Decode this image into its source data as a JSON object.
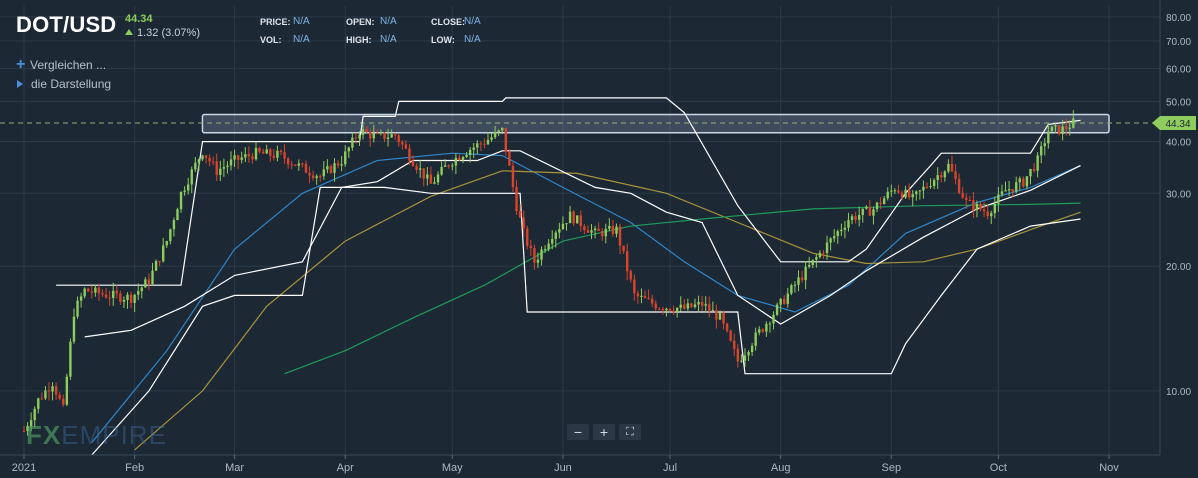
{
  "header": {
    "ticker": "DOT/USD",
    "last": "44.34",
    "change": "1.32 (3.07%)",
    "ohlc": [
      {
        "label": "PRICE:",
        "value": "N/A"
      },
      {
        "label": "VOL:",
        "value": "N/A"
      },
      {
        "label": "OPEN:",
        "value": "N/A"
      },
      {
        "label": "HIGH:",
        "value": "N/A"
      },
      {
        "label": "CLOSE:",
        "value": "N/A"
      },
      {
        "label": "LOW:",
        "value": "N/A"
      }
    ]
  },
  "menu": {
    "compare": "Vergleichen ...",
    "display": "die Darstellung"
  },
  "zoom": {
    "minus": "−",
    "plus": "+",
    "fullscreen": "⛶"
  },
  "logo": {
    "fx": "FX",
    "empire": "EMPIRE"
  },
  "colors": {
    "up": "#8dcc5d",
    "down": "#d9442c",
    "ma_fast": "#2f86c8",
    "ma_mid": "#a8943c",
    "ma_slow": "#1f9a5a",
    "channel": "#ffffff",
    "resistance_box": "#c8d6e8"
  },
  "chart_data": {
    "type": "candlestick",
    "symbol": "DOT/USD",
    "y_scale": "log",
    "ylim": [
      7,
      85
    ],
    "y_ticks": [
      10,
      20,
      30,
      40,
      50,
      60,
      70,
      80
    ],
    "y_tick_labels": [
      "10.00",
      "20.00",
      "30.00",
      "40.00",
      "50.00",
      "60.00",
      "70.00",
      "80.00"
    ],
    "x_range": [
      "2021-01-01",
      "2021-11-08"
    ],
    "x_ticks": [
      {
        "date": "2021-01-01",
        "label": "2021"
      },
      {
        "date": "2021-02-01",
        "label": "Feb"
      },
      {
        "date": "2021-03-01",
        "label": "Mar"
      },
      {
        "date": "2021-04-01",
        "label": "Apr"
      },
      {
        "date": "2021-05-01",
        "label": "May"
      },
      {
        "date": "2021-06-01",
        "label": "Jun"
      },
      {
        "date": "2021-07-01",
        "label": "Jul"
      },
      {
        "date": "2021-08-01",
        "label": "Aug"
      },
      {
        "date": "2021-09-01",
        "label": "Sep"
      },
      {
        "date": "2021-10-01",
        "label": "Oct"
      },
      {
        "date": "2021-11-01",
        "label": "Nov"
      }
    ],
    "last_price": 44.34,
    "last_price_label": "44.34",
    "resistance_zone": {
      "from": "2021-02-20",
      "to": "2021-11-01",
      "low": 42.0,
      "high": 46.5,
      "level": 44.34
    },
    "price_path": [
      [
        "2021-01-01",
        8.0
      ],
      [
        "2021-01-05",
        9.5
      ],
      [
        "2021-01-09",
        10.5
      ],
      [
        "2021-01-12",
        9.0
      ],
      [
        "2021-01-15",
        15.5
      ],
      [
        "2021-01-18",
        17.5
      ],
      [
        "2021-01-25",
        17.0
      ],
      [
        "2021-01-31",
        16.8
      ],
      [
        "2021-02-05",
        18.5
      ],
      [
        "2021-02-10",
        23.0
      ],
      [
        "2021-02-14",
        30.0
      ],
      [
        "2021-02-20",
        38.0
      ],
      [
        "2021-02-24",
        34.0
      ],
      [
        "2021-03-01",
        36.0
      ],
      [
        "2021-03-07",
        37.5
      ],
      [
        "2021-03-14",
        37.0
      ],
      [
        "2021-03-20",
        34.5
      ],
      [
        "2021-03-25",
        33.0
      ],
      [
        "2021-03-31",
        36.0
      ],
      [
        "2021-04-05",
        42.5
      ],
      [
        "2021-04-10",
        41.0
      ],
      [
        "2021-04-15",
        41.5
      ],
      [
        "2021-04-20",
        36.0
      ],
      [
        "2021-04-25",
        31.5
      ],
      [
        "2021-04-30",
        35.5
      ],
      [
        "2021-05-05",
        38.0
      ],
      [
        "2021-05-10",
        40.0
      ],
      [
        "2021-05-15",
        42.5
      ],
      [
        "2021-05-19",
        28.0
      ],
      [
        "2021-05-21",
        24.0
      ],
      [
        "2021-05-24",
        20.5
      ],
      [
        "2021-05-29",
        24.0
      ],
      [
        "2021-06-03",
        26.5
      ],
      [
        "2021-06-10",
        24.0
      ],
      [
        "2021-06-16",
        24.5
      ],
      [
        "2021-06-21",
        17.0
      ],
      [
        "2021-06-28",
        16.0
      ],
      [
        "2021-07-05",
        15.8
      ],
      [
        "2021-07-10",
        16.2
      ],
      [
        "2021-07-15",
        15.0
      ],
      [
        "2021-07-20",
        11.8
      ],
      [
        "2021-07-25",
        13.5
      ],
      [
        "2021-07-31",
        15.8
      ],
      [
        "2021-08-06",
        18.5
      ],
      [
        "2021-08-13",
        22.0
      ],
      [
        "2021-08-20",
        26.0
      ],
      [
        "2021-08-27",
        27.5
      ],
      [
        "2021-09-02",
        31.0
      ],
      [
        "2021-09-07",
        29.0
      ],
      [
        "2021-09-12",
        32.0
      ],
      [
        "2021-09-17",
        35.0
      ],
      [
        "2021-09-22",
        28.5
      ],
      [
        "2021-09-28",
        27.0
      ],
      [
        "2021-10-03",
        30.5
      ],
      [
        "2021-10-08",
        32.0
      ],
      [
        "2021-10-12",
        36.0
      ],
      [
        "2021-10-15",
        42.5
      ],
      [
        "2021-10-19",
        42.8
      ],
      [
        "2021-10-22",
        44.34
      ]
    ],
    "moving_averages": [
      {
        "color": "#2f86c8",
        "points": [
          [
            "2021-01-20",
            7.5
          ],
          [
            "2021-02-10",
            12.5
          ],
          [
            "2021-03-01",
            22.0
          ],
          [
            "2021-03-20",
            30.0
          ],
          [
            "2021-04-10",
            36.0
          ],
          [
            "2021-05-01",
            37.5
          ],
          [
            "2021-05-15",
            37.0
          ],
          [
            "2021-06-01",
            31.0
          ],
          [
            "2021-06-20",
            25.5
          ],
          [
            "2021-07-05",
            20.5
          ],
          [
            "2021-07-20",
            17.0
          ],
          [
            "2021-08-05",
            15.5
          ],
          [
            "2021-08-20",
            18.0
          ],
          [
            "2021-09-05",
            24.0
          ],
          [
            "2021-09-25",
            28.5
          ],
          [
            "2021-10-10",
            31.0
          ],
          [
            "2021-10-24",
            35.0
          ]
        ]
      },
      {
        "color": "#a8943c",
        "points": [
          [
            "2021-02-01",
            7.2
          ],
          [
            "2021-02-20",
            10.0
          ],
          [
            "2021-03-10",
            16.0
          ],
          [
            "2021-04-01",
            23.0
          ],
          [
            "2021-04-25",
            29.5
          ],
          [
            "2021-05-15",
            34.0
          ],
          [
            "2021-06-05",
            33.5
          ],
          [
            "2021-06-30",
            30.0
          ],
          [
            "2021-07-20",
            25.5
          ],
          [
            "2021-08-10",
            21.5
          ],
          [
            "2021-08-25",
            20.3
          ],
          [
            "2021-09-10",
            20.5
          ],
          [
            "2021-09-25",
            22.0
          ],
          [
            "2021-10-10",
            24.5
          ],
          [
            "2021-10-24",
            27.0
          ]
        ]
      },
      {
        "color": "#1f9a5a",
        "points": [
          [
            "2021-03-15",
            11.0
          ],
          [
            "2021-04-01",
            12.5
          ],
          [
            "2021-04-20",
            15.0
          ],
          [
            "2021-05-10",
            18.0
          ],
          [
            "2021-06-01",
            23.0
          ],
          [
            "2021-06-20",
            25.0
          ],
          [
            "2021-07-10",
            26.0
          ],
          [
            "2021-08-10",
            27.5
          ],
          [
            "2021-09-10",
            28.0
          ],
          [
            "2021-10-10",
            28.2
          ],
          [
            "2021-10-24",
            28.4
          ]
        ]
      }
    ],
    "channel_bands": [
      [
        [
          "2021-01-10",
          18.0
        ],
        [
          "2021-01-18",
          18.0
        ],
        [
          "2021-02-14",
          18.0
        ],
        [
          "2021-02-20",
          40.0
        ],
        [
          "2021-04-05",
          40.0
        ],
        [
          "2021-04-06",
          46.0
        ],
        [
          "2021-04-15",
          46.0
        ],
        [
          "2021-04-16",
          50.0
        ],
        [
          "2021-05-15",
          50.0
        ],
        [
          "2021-05-16",
          51.0
        ],
        [
          "2021-06-30",
          51.0
        ],
        [
          "2021-07-05",
          47.0
        ],
        [
          "2021-07-20",
          28.0
        ],
        [
          "2021-08-01",
          20.5
        ],
        [
          "2021-08-20",
          20.5
        ],
        [
          "2021-08-25",
          22.0
        ],
        [
          "2021-09-05",
          30.0
        ],
        [
          "2021-09-12",
          35.0
        ],
        [
          "2021-09-15",
          37.5
        ],
        [
          "2021-10-10",
          37.5
        ],
        [
          "2021-10-15",
          44.0
        ],
        [
          "2021-10-24",
          45.0
        ]
      ],
      [
        [
          "2021-01-18",
          13.5
        ],
        [
          "2021-01-31",
          14.0
        ],
        [
          "2021-02-15",
          16.0
        ],
        [
          "2021-03-01",
          19.0
        ],
        [
          "2021-03-20",
          20.5
        ],
        [
          "2021-03-31",
          31.0
        ],
        [
          "2021-04-10",
          32.0
        ],
        [
          "2021-04-20",
          36.0
        ],
        [
          "2021-05-08",
          36.0
        ],
        [
          "2021-05-15",
          38.0
        ],
        [
          "2021-05-20",
          38.0
        ],
        [
          "2021-06-10",
          31.0
        ],
        [
          "2021-06-20",
          30.0
        ],
        [
          "2021-06-30",
          27.0
        ],
        [
          "2021-07-10",
          25.5
        ],
        [
          "2021-07-20",
          17.0
        ],
        [
          "2021-08-01",
          14.5
        ],
        [
          "2021-08-15",
          17.0
        ],
        [
          "2021-08-25",
          19.5
        ],
        [
          "2021-09-10",
          23.5
        ],
        [
          "2021-09-25",
          27.5
        ],
        [
          "2021-10-10",
          30.5
        ],
        [
          "2021-10-24",
          35.0
        ]
      ],
      [
        [
          "2021-01-20",
          7.0
        ],
        [
          "2021-02-05",
          10.0
        ],
        [
          "2021-02-20",
          16.0
        ],
        [
          "2021-03-01",
          17.0
        ],
        [
          "2021-03-20",
          17.0
        ],
        [
          "2021-03-25",
          31.0
        ],
        [
          "2021-04-12",
          31.0
        ],
        [
          "2021-04-25",
          30.0
        ],
        [
          "2021-05-20",
          30.0
        ],
        [
          "2021-05-22",
          15.5
        ],
        [
          "2021-07-20",
          15.5
        ],
        [
          "2021-07-22",
          11.0
        ],
        [
          "2021-09-01",
          11.0
        ],
        [
          "2021-09-05",
          13.0
        ],
        [
          "2021-09-15",
          17.0
        ],
        [
          "2021-09-25",
          22.0
        ],
        [
          "2021-10-10",
          25.0
        ],
        [
          "2021-10-24",
          26.0
        ]
      ]
    ]
  }
}
